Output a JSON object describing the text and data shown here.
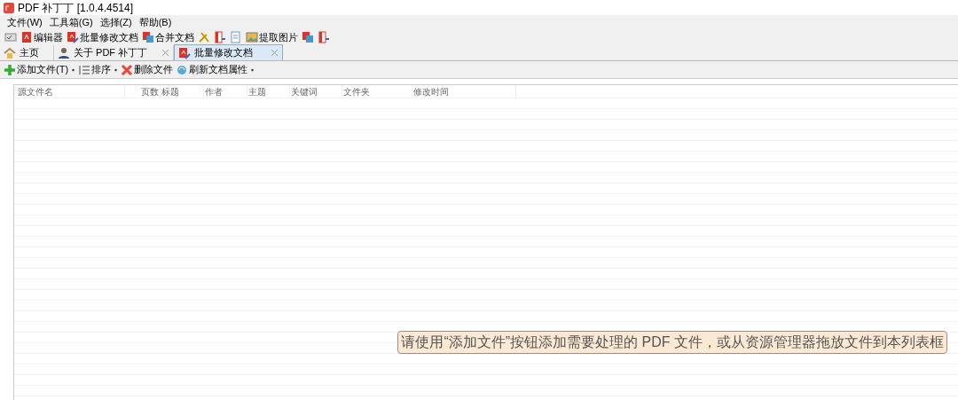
{
  "window": {
    "title": "PDF 补丁丁 [1.0.4.4514]"
  },
  "menu": [
    "文件(W)",
    "工具箱(G)",
    "选择(Z)",
    "帮助(B)"
  ],
  "toolbar": [
    {
      "kind": "icon"
    },
    {
      "kind": "button",
      "label": "编辑器"
    },
    {
      "kind": "button",
      "label": "批量修改文档"
    },
    {
      "kind": "button",
      "label": "合并文档"
    },
    {
      "kind": "icon"
    },
    {
      "kind": "icon"
    },
    {
      "kind": "icon"
    },
    {
      "kind": "button",
      "label": "提取图片"
    },
    {
      "kind": "icon"
    },
    {
      "kind": "icon"
    }
  ],
  "tabs": [
    {
      "label": "主页",
      "closable": false,
      "selected": false
    },
    {
      "label": "关于 PDF 补丁丁",
      "closable": true,
      "selected": false
    },
    {
      "label": "批量修改文档",
      "closable": true,
      "selected": true
    }
  ],
  "subtoolbar": [
    {
      "label": "添加文件(T)",
      "dropdown": true
    },
    {
      "label": "排序",
      "dropdown": true
    },
    {
      "label": "删除文件",
      "dropdown": false
    },
    {
      "label": "刷新文档属性",
      "dropdown": true
    }
  ],
  "table": {
    "columns": [
      "源文件名",
      "页数",
      "标题",
      "作者",
      "主题",
      "关键词",
      "文件夹",
      "修改时间"
    ]
  },
  "hint": "请使用“添加文件”按钮添加需要处理的 PDF 文件，或从资源管理器拖放文件到本列表框"
}
